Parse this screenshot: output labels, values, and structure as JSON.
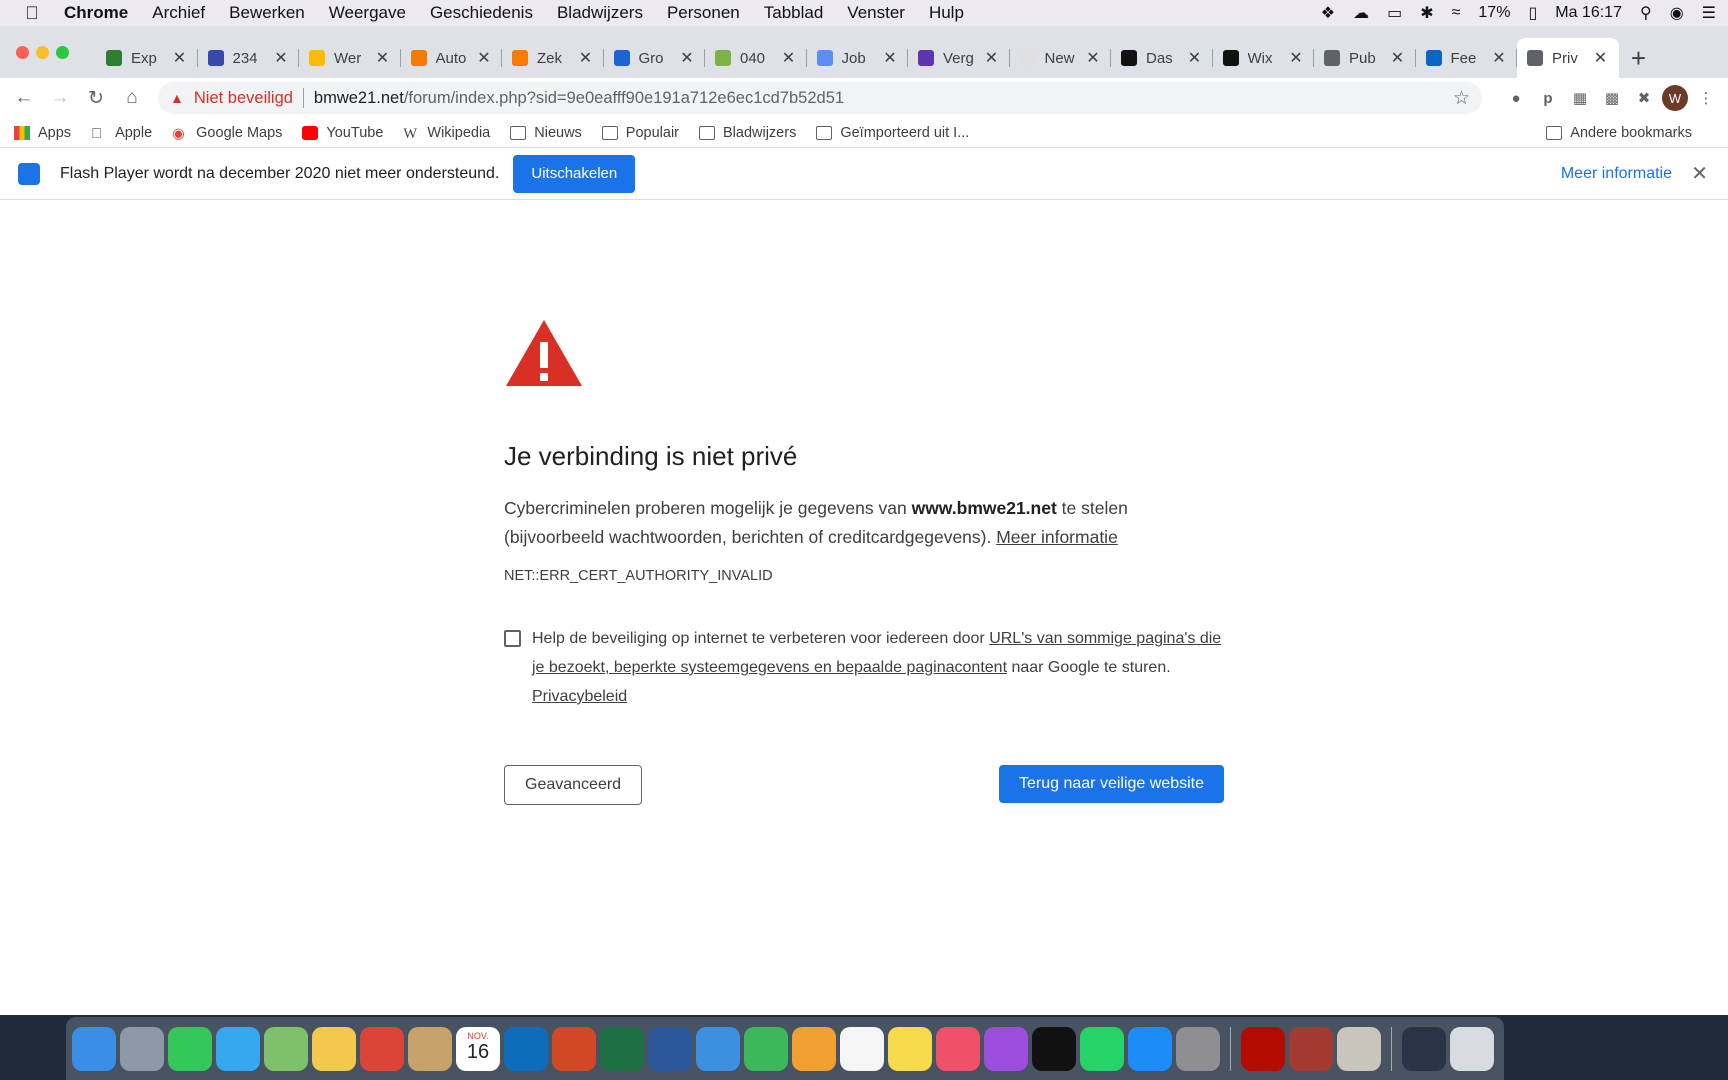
{
  "menubar": {
    "app": "Chrome",
    "items": [
      "Archief",
      "Bewerken",
      "Weergave",
      "Geschiedenis",
      "Bladwijzers",
      "Personen",
      "Tabblad",
      "Venster",
      "Hulp"
    ],
    "battery": "17%",
    "clock": "Ma 16:17"
  },
  "tabs": [
    {
      "title": "Exp",
      "color": "#2e7d32"
    },
    {
      "title": "234",
      "color": "#3949ab"
    },
    {
      "title": "Wer",
      "color": "#fbbc04"
    },
    {
      "title": "Auto",
      "color": "#f57c00"
    },
    {
      "title": "Zek",
      "color": "#f57c00"
    },
    {
      "title": "Gro",
      "color": "#1e63d6"
    },
    {
      "title": "040",
      "color": "#7cb342"
    },
    {
      "title": "Job",
      "color": "#5c8df6"
    },
    {
      "title": "Verg",
      "color": "#5e35b1"
    },
    {
      "title": "New",
      "color": "#e0e0e0"
    },
    {
      "title": "Das",
      "color": "#111111"
    },
    {
      "title": "Wix",
      "color": "#111111"
    },
    {
      "title": "Pub",
      "color": "#5f6368"
    },
    {
      "title": "Fee",
      "color": "#0a66c2"
    },
    {
      "title": "Priv",
      "color": "#5f6368"
    }
  ],
  "toolbar": {
    "security_label": "Niet beveiligd",
    "url_host": "bmwe21.net",
    "url_path": "/forum/index.php?sid=9e0eafff90e191a712e6ec1cd7b52d51",
    "profile_initial": "W"
  },
  "bookmarks": [
    {
      "label": "Apps",
      "icon": "apps-grid-icon"
    },
    {
      "label": "Apple",
      "icon": "apple-icon"
    },
    {
      "label": "Google Maps",
      "icon": "maps-pin-icon"
    },
    {
      "label": "YouTube",
      "icon": "youtube-icon"
    },
    {
      "label": "Wikipedia",
      "icon": "wikipedia-icon"
    },
    {
      "label": "Nieuws",
      "icon": "folder-icon"
    },
    {
      "label": "Populair",
      "icon": "folder-icon"
    },
    {
      "label": "Bladwijzers",
      "icon": "folder-icon"
    },
    {
      "label": "Geïmporteerd uit I...",
      "icon": "folder-icon"
    }
  ],
  "bookmarks_other": "Andere bookmarks",
  "infobar": {
    "message": "Flash Player wordt na december 2020 niet meer ondersteund.",
    "button": "Uitschakelen",
    "more": "Meer informatie"
  },
  "interstitial": {
    "title": "Je verbinding is niet privé",
    "desc_pre": "Cybercriminelen proberen mogelijk je gegevens van ",
    "desc_host": "www.bmwe21.net",
    "desc_post": " te stelen (bijvoorbeeld wachtwoorden, berichten of creditcardgegevens). ",
    "desc_link": "Meer informatie",
    "error_code": "NET::ERR_CERT_AUTHORITY_INVALID",
    "optin_pre": "Help de beveiliging op internet te verbeteren voor iedereen door ",
    "optin_link": "URL's van sommige pagina's die je bezoekt, beperkte systeemgegevens en bepaalde paginacontent",
    "optin_post": " naar Google te sturen. ",
    "privacy_link": "Privacybeleid",
    "advanced_button": "Geavanceerd",
    "back_button": "Terug naar veilige website"
  },
  "dock": {
    "calendar_month": "NOV.",
    "calendar_day": "16",
    "apps": [
      {
        "name": "finder",
        "color": "#3a8ee6"
      },
      {
        "name": "launchpad",
        "color": "#8d99a6"
      },
      {
        "name": "facetime",
        "color": "#34c759"
      },
      {
        "name": "messages",
        "color": "#35a8f0"
      },
      {
        "name": "maps",
        "color": "#7fc06b"
      },
      {
        "name": "photos",
        "color": "#f2c94c"
      },
      {
        "name": "chrome",
        "color": "#db4437"
      },
      {
        "name": "contacts",
        "color": "#c8a26b"
      },
      {
        "name": "calendar",
        "color": "#ffffff"
      },
      {
        "name": "outlook",
        "color": "#0f6cbd"
      },
      {
        "name": "powerpoint",
        "color": "#d24726"
      },
      {
        "name": "excel",
        "color": "#1d7044"
      },
      {
        "name": "word",
        "color": "#2b579a"
      },
      {
        "name": "keynote",
        "color": "#3d8fe0"
      },
      {
        "name": "numbers",
        "color": "#3eb65a"
      },
      {
        "name": "pages",
        "color": "#f0a030"
      },
      {
        "name": "reminders",
        "color": "#f5f5f5"
      },
      {
        "name": "notes",
        "color": "#f7d94c"
      },
      {
        "name": "music",
        "color": "#f1506b"
      },
      {
        "name": "podcasts",
        "color": "#9b4dde"
      },
      {
        "name": "tv",
        "color": "#111111"
      },
      {
        "name": "whatsapp",
        "color": "#25d366"
      },
      {
        "name": "app-store",
        "color": "#1d8cf8"
      },
      {
        "name": "system-preferences",
        "color": "#8e8e93"
      },
      {
        "name": "acrobat",
        "color": "#b30b00"
      },
      {
        "name": "dictionary",
        "color": "#a33a32"
      },
      {
        "name": "calculator",
        "color": "#c9c4bc"
      },
      {
        "name": "document",
        "color": "#2a3447"
      },
      {
        "name": "trash",
        "color": "#d8dbe0"
      }
    ]
  }
}
